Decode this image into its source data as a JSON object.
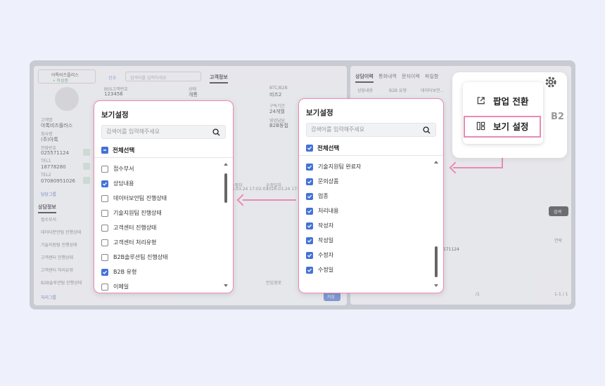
{
  "background_app": {
    "company_select": "아톡비즈플러스",
    "company_badge": "• 작성중",
    "new_button": "신규",
    "top_search_placeholder": "검색어를 입력하세요",
    "customer_info_tab": "고객정보",
    "fields": [
      {
        "label": "BSS고객번호",
        "value": "123456"
      },
      {
        "label": "상태",
        "value": "개통"
      },
      {
        "label": "BTC/B2B",
        "value": "비즈2"
      },
      {
        "label": "구독기간",
        "value": "24개월"
      },
      {
        "label": "영업담당",
        "value": "B2B동접"
      }
    ],
    "customer_name_label": "고객명",
    "customer_name": "아톡비즈플러스",
    "company_label": "회사명",
    "company_value": "(주)아톡",
    "phone_label": "전화번호",
    "phone": "025571124",
    "tel1_label": "TEL1",
    "tel1": "18778280",
    "tel2_label": "TEL2",
    "tel2": "07080951026",
    "manager_group": "담당그룹",
    "consult_info_tab": "상담정보",
    "consult_fields": [
      "접수부서",
      "데이터분만팀 진행상태",
      "기술지원팀 진행상태",
      "고객센터 진행상태",
      "고객센터 처리유형",
      "B2B솔루션팀 진행상태"
    ],
    "dates": {
      "created_label": "수정자",
      "created": "2026.03.24 17:02:07",
      "modified_label": "수정일자",
      "modified": "2026.03.24 17:03"
    },
    "inflow_label": "인입경로",
    "process_group": "처리그룹",
    "save_button": "저장",
    "right_tabs": [
      "상담이력",
      "통화내역",
      "문자이력",
      "파일함"
    ],
    "right_columns": [
      "상담내용",
      "B2B 유형",
      "데이터보안..."
    ],
    "search_button": "검색",
    "phone_col": "연락",
    "phone_cell": "571124",
    "pager_info": "/1",
    "pager_total": "1-1 / 1",
    "b2b_fragment": "B2"
  },
  "modal_left": {
    "title": "보기설정",
    "search_placeholder": "검색어를 입력해주세요",
    "select_all": "전체선택",
    "items": [
      {
        "label": "접수부서",
        "checked": false
      },
      {
        "label": "상담내용",
        "checked": true
      },
      {
        "label": "데이터보안팀 진행상태",
        "checked": false
      },
      {
        "label": "기술지원팀 진행상태",
        "checked": false
      },
      {
        "label": "고객센터 진행상태",
        "checked": false
      },
      {
        "label": "고객센터 처리유형",
        "checked": false
      },
      {
        "label": "B2B솔루션팀 진행상태",
        "checked": false
      },
      {
        "label": "B2B 유형",
        "checked": true
      },
      {
        "label": "이메일",
        "checked": false
      }
    ]
  },
  "modal_right": {
    "title": "보기설정",
    "search_placeholder": "검색어를 입력해주세요",
    "select_all": "전체선택",
    "items": [
      {
        "label": "",
        "checked": true
      },
      {
        "label": "기술지원팀 완료자",
        "checked": true
      },
      {
        "label": "문의상품",
        "checked": true
      },
      {
        "label": "업종",
        "checked": true
      },
      {
        "label": "처리내용",
        "checked": true
      },
      {
        "label": "작성자",
        "checked": true
      },
      {
        "label": "작성일",
        "checked": true
      },
      {
        "label": "수정자",
        "checked": true
      },
      {
        "label": "수정일",
        "checked": true
      }
    ]
  },
  "popup_menu": {
    "popup_switch": "팝업 전환",
    "view_settings": "보기 설정"
  },
  "colors": {
    "accent_pink": "#e98ab5",
    "checkbox_blue": "#4472d6"
  }
}
